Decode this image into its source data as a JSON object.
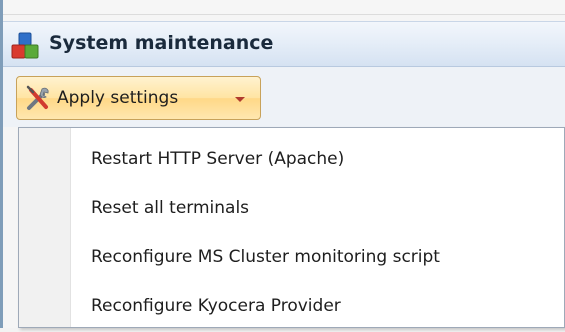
{
  "header": {
    "title": "System maintenance",
    "icon": "colored-blocks-icon"
  },
  "toolbar": {
    "apply_label": "Apply settings",
    "apply_icon": "tools-icon",
    "arrow_icon": "chevron-down-icon"
  },
  "menu": {
    "items": [
      {
        "label": "Restart HTTP Server (Apache)"
      },
      {
        "label": "Reset all terminals"
      },
      {
        "label": "Reconfigure MS Cluster monitoring script"
      },
      {
        "label": "Reconfigure Kyocera Provider"
      }
    ]
  },
  "colors": {
    "header_blue": "#d5e2f2",
    "button_orange": "#ffd887",
    "menu_background": "#ffffff"
  }
}
